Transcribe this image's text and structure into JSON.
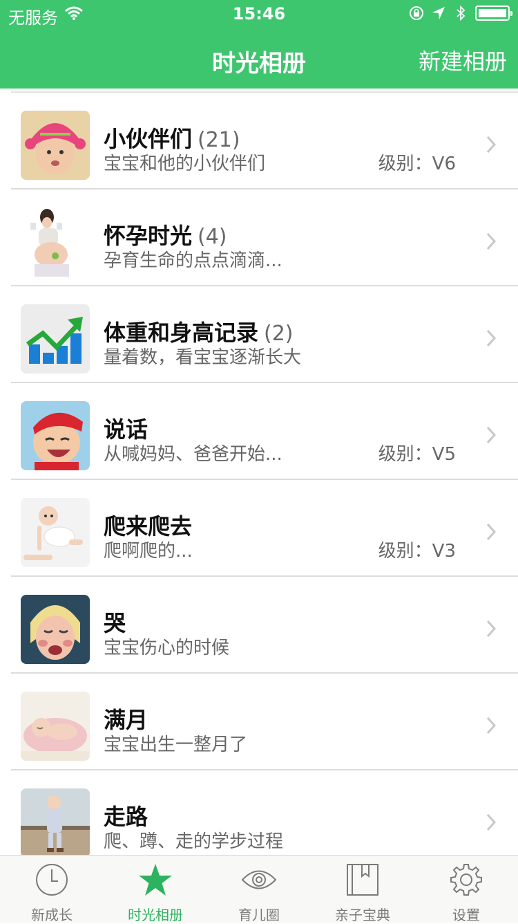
{
  "status_bar": {
    "carrier": "无服务",
    "time": "15:46"
  },
  "nav": {
    "title": "时光相册",
    "action": "新建相册"
  },
  "albums": [
    {
      "title": "小伙伴们",
      "count": "(21)",
      "subtitle": "宝宝和他的小伙伴们",
      "level": "级别：V6",
      "thumb": "baby-pink-hat-photo"
    },
    {
      "title": "怀孕时光",
      "count": "(4)",
      "subtitle": "孕育生命的点点滴滴...",
      "level": "",
      "thumb": "pregnant-woman-photo"
    },
    {
      "title": "体重和身高记录",
      "count": "(2)",
      "subtitle": "量着数，看宝宝逐渐长大",
      "level": "",
      "thumb": "growth-chart-icon"
    },
    {
      "title": "说话",
      "count": "",
      "subtitle": "从喊妈妈、爸爸开始...",
      "level": "级别：V5",
      "thumb": "laughing-baby-photo"
    },
    {
      "title": "爬来爬去",
      "count": "",
      "subtitle": "爬啊爬的...",
      "level": "级别：V3",
      "thumb": "crawling-baby-photo"
    },
    {
      "title": "哭",
      "count": "",
      "subtitle": "宝宝伤心的时候",
      "level": "",
      "thumb": "crying-child-photo"
    },
    {
      "title": "满月",
      "count": "",
      "subtitle": "宝宝出生一整月了",
      "level": "",
      "thumb": "sleeping-newborn-photo"
    },
    {
      "title": "走路",
      "count": "",
      "subtitle": "爬、蹲、走的学步过程",
      "level": "",
      "thumb": "walking-toddler-photo"
    }
  ],
  "tabs": [
    {
      "label": "新成长",
      "icon": "clock-icon",
      "active": false
    },
    {
      "label": "时光相册",
      "icon": "star-icon",
      "active": true
    },
    {
      "label": "育儿圈",
      "icon": "eye-icon",
      "active": false
    },
    {
      "label": "亲子宝典",
      "icon": "book-icon",
      "active": false
    },
    {
      "label": "设置",
      "icon": "gear-icon",
      "active": false
    }
  ],
  "colors": {
    "accent": "#3ec66f",
    "tab_active": "#2db25f",
    "tab_inactive": "#7a7a7a"
  }
}
